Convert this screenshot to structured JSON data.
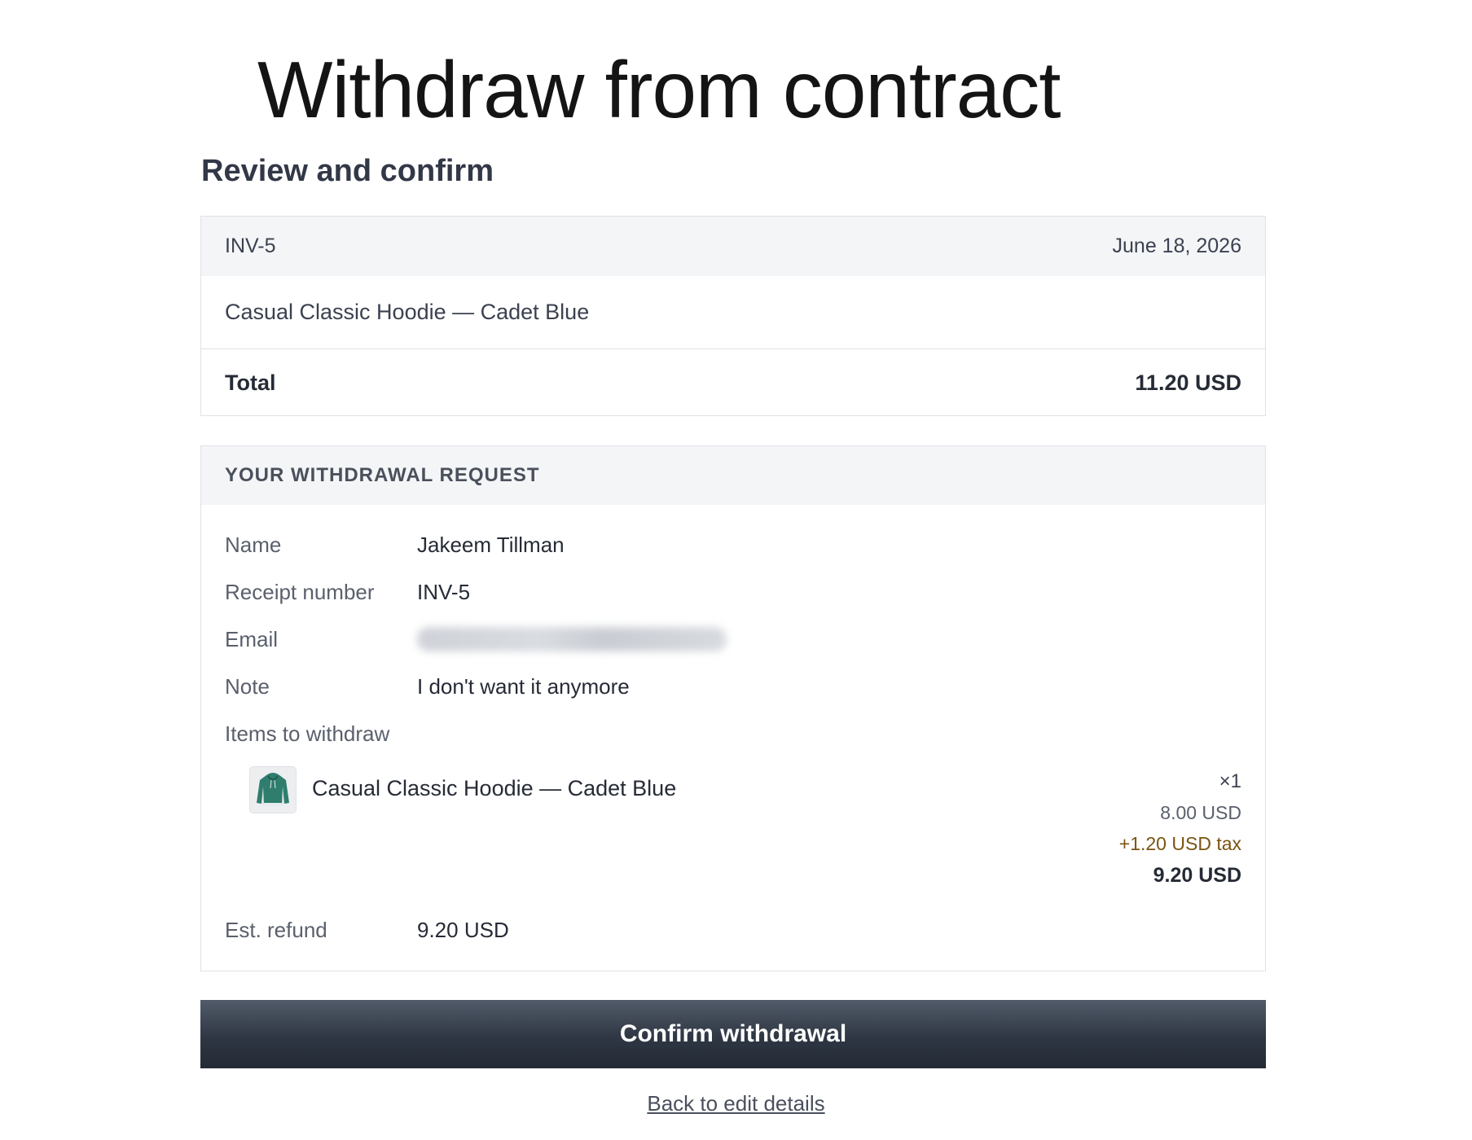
{
  "page": {
    "title": "Withdraw from contract",
    "section_title": "Review and confirm"
  },
  "order": {
    "receipt": "INV-5",
    "date": "June 18, 2026",
    "product": "Casual Classic Hoodie — Cadet Blue",
    "total_label": "Total",
    "total_value": "11.20 USD"
  },
  "request": {
    "heading": "YOUR WITHDRAWAL REQUEST",
    "name_label": "Name",
    "name_value": "Jakeem Tillman",
    "receipt_label": "Receipt number",
    "receipt_value": "INV-5",
    "email_label": "Email",
    "note_label": "Note",
    "note_value": "I don't want it anymore",
    "items_label": "Items to withdraw",
    "item": {
      "name": "Casual Classic Hoodie — Cadet Blue",
      "thumbnail_icon": "hoodie-icon",
      "thumbnail_color": "#2f7d6d",
      "quantity": "×1",
      "unit_price": "8.00 USD",
      "tax": "+1.20 USD tax",
      "line_total": "9.20 USD"
    },
    "refund_label": "Est. refund",
    "refund_value": "9.20 USD"
  },
  "actions": {
    "confirm_label": "Confirm withdrawal",
    "back_label": "Back to edit details"
  },
  "colors": {
    "button_dark": "#2f3744",
    "tax_text": "#7a5510"
  }
}
